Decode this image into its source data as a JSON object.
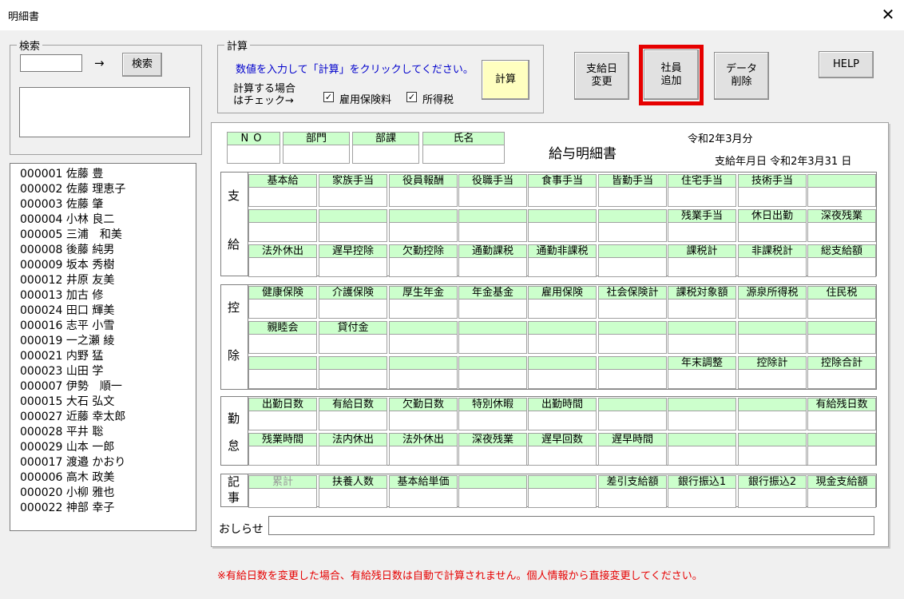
{
  "window": {
    "title": "明細書",
    "close": "✕"
  },
  "search": {
    "legend": "検索",
    "arrow": "→",
    "button": "検索"
  },
  "employees": [
    "000001 佐藤 豊",
    "000002 佐藤 理恵子",
    "000003 佐藤 肇",
    "000004 小林 良二",
    "000005 三浦　和美",
    "000008 後藤 純男",
    "000009 坂本 秀樹",
    "000012 井原 友美",
    "000013 加古 修",
    "000024 田口 輝美",
    "000016 志平 小雪",
    "000019 一之瀬 綾",
    "000021 内野 猛",
    "000023 山田 学",
    "000007 伊勢　順一",
    "000015 大石 弘文",
    "000027 近藤 幸太郎",
    "000028 平井 聡",
    "000029 山本 一郎",
    "000017 渡邉 かおり",
    "000006 高木 政美",
    "000020 小柳 雅也",
    "000022 神部 幸子"
  ],
  "calc": {
    "legend": "計算",
    "instruction": "数値を入力して「計算」をクリックしてください。",
    "check_line1": "計算する場合",
    "check_line2": "はチェック→",
    "check1": "雇用保険料",
    "check2": "所得税",
    "checkmark": "✓",
    "button": "計算"
  },
  "buttons": {
    "change_date": [
      "支給日",
      "変更"
    ],
    "add_employee": [
      "社員",
      "追加"
    ],
    "delete_data": [
      "データ",
      "削除"
    ],
    "help": "HELP"
  },
  "sheet": {
    "header_labels": [
      "NO",
      "部門",
      "部課",
      "氏名"
    ],
    "title": "給与明細書",
    "period": "令和2年3月分",
    "pay_date": "支給年月日 令和2年3月31 日",
    "sections": {
      "pay": [
        "支",
        "給"
      ],
      "ded": [
        "控",
        "除"
      ],
      "att": [
        "勤",
        "怠"
      ],
      "note": [
        "記",
        "事"
      ]
    },
    "pay_row1": [
      "基本給",
      "家族手当",
      "役員報酬",
      "役職手当",
      "食事手当",
      "皆勤手当",
      "住宅手当",
      "技術手当",
      ""
    ],
    "pay_row2": [
      "",
      "",
      "",
      "",
      "",
      "",
      "残業手当",
      "休日出勤",
      "深夜残業"
    ],
    "pay_row3": [
      "法外休出",
      "遅早控除",
      "欠勤控除",
      "通勤課税",
      "通勤非課税",
      "",
      "課税計",
      "非課税計",
      "総支給額"
    ],
    "ded_row1": [
      "健康保険",
      "介護保険",
      "厚生年金",
      "年金基金",
      "雇用保険",
      "社会保険計",
      "課税対象額",
      "源泉所得税",
      "住民税"
    ],
    "ded_row2": [
      "親睦会",
      "貸付金",
      "",
      "",
      "",
      "",
      "",
      "",
      ""
    ],
    "ded_row3": [
      "",
      "",
      "",
      "",
      "",
      "",
      "年末調整",
      "控除計",
      "控除合計"
    ],
    "att_row1": [
      "出勤日数",
      "有給日数",
      "欠勤日数",
      "特別休暇",
      "出勤時間",
      "",
      "",
      "",
      "有給残日数"
    ],
    "att_row2": [
      "残業時間",
      "法内休出",
      "法外休出",
      "深夜残業",
      "遅早回数",
      "遅早時間",
      "",
      "",
      ""
    ],
    "note_row": [
      "累計",
      "扶養人数",
      "基本給単価",
      "",
      "",
      "差引支給額",
      "銀行振込1",
      "銀行振込2",
      "現金支給額"
    ],
    "notice_label": "おしらせ"
  },
  "footer_note": "※有給日数を変更した場合、有給残日数は自動で計算されません。個人情報から直接変更してください。",
  "colors": {
    "label_bg": "#ccffcc",
    "highlight": "#e60000",
    "note": "#e60000",
    "instruction": "#0000cc",
    "calc_button": "#ffffc0"
  }
}
